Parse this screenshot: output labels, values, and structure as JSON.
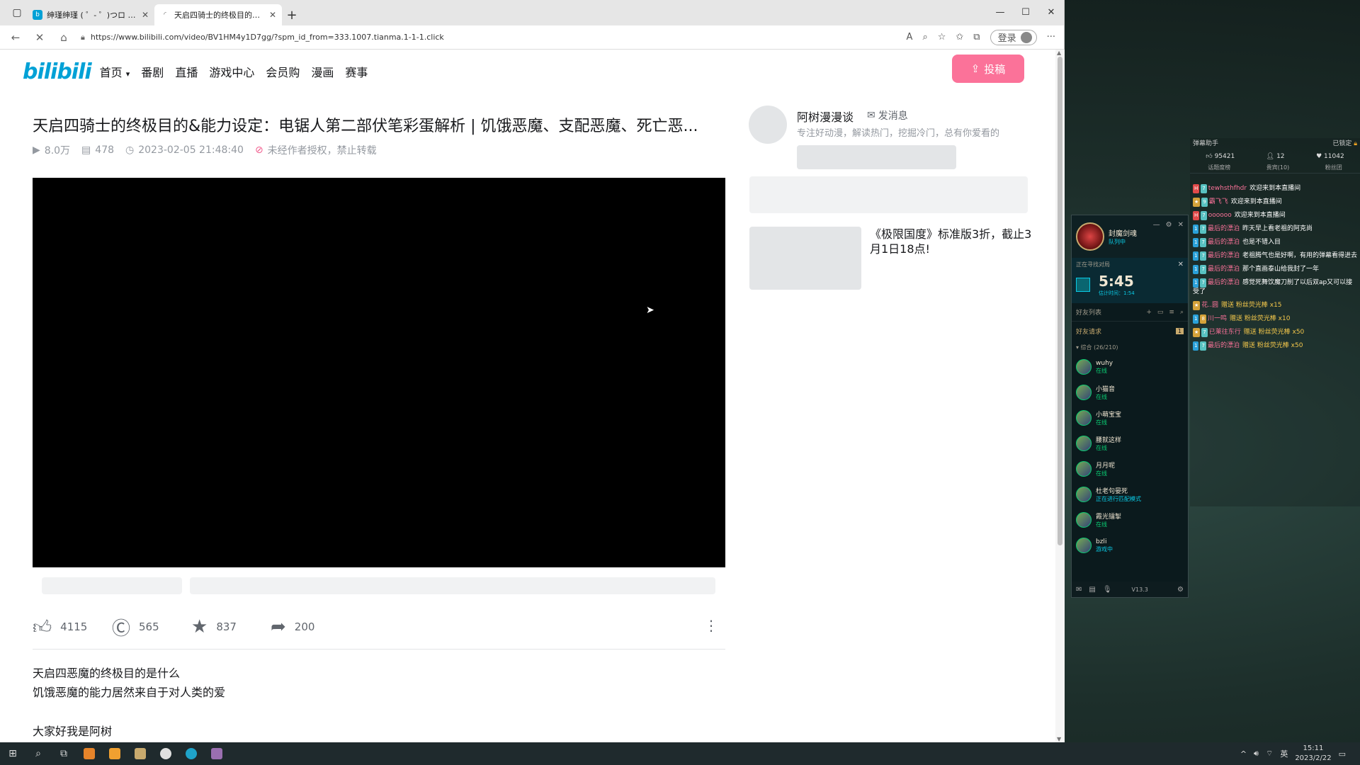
{
  "browser": {
    "tabs": [
      {
        "title": "绅瑾绅瑾 ( ゜- ゜)つロ 干杯~-bilibili",
        "active": false
      },
      {
        "title": "天启四骑士的终极目的&能力设定",
        "active": true
      }
    ],
    "url": "https://www.bilibili.com/video/BV1HM4y1D7gg/?spm_id_from=333.1007.tianma.1-1-1.click",
    "login_label": "登录"
  },
  "header": {
    "logo": "bilibili",
    "nav": [
      "首页",
      "番剧",
      "直播",
      "游戏中心",
      "会员购",
      "漫画",
      "赛事"
    ],
    "upload_label": "投稿"
  },
  "video": {
    "title": "天启四骑士的终极目的&能力设定：电锯人第二部伏笔彩蛋解析 | 饥饿恶魔、支配恶魔、死亡恶...",
    "views": "8.0万",
    "danmaku": "478",
    "date": "2023-02-05 21:48:40",
    "copyright": "未经作者授权，禁止转载",
    "likes": "4115",
    "coins": "565",
    "favorites": "837",
    "shares": "200",
    "description": [
      "天启四恶魔的终极目的是什么",
      "饥饿恶魔的能力居然来自于对人类的爱",
      "大家好我是阿树"
    ]
  },
  "uploader": {
    "name": "阿树漫漫谈",
    "message_label": "发消息",
    "bio": "专注好动漫，解读热门，挖掘冷门，总有你爱看的"
  },
  "ad": {
    "text": "《极限国度》标准版3折，截止3月1日18点!"
  },
  "lol": {
    "summoner": "封魔剑魂",
    "status": "队列中",
    "level": "518",
    "queue_label": "正在寻找对局",
    "timer": "5:45",
    "eta": "估计时间：1:54",
    "friends_label": "好友列表",
    "friend_requests_label": "好友请求",
    "friend_requests_count": "1",
    "group_label": "▾ 综合 (26/210)",
    "friends": [
      {
        "name": "wuhy",
        "status": "在线",
        "game": false
      },
      {
        "name": "小猫音",
        "status": "在线",
        "game": false
      },
      {
        "name": "小萌宝宝",
        "status": "在线",
        "game": false
      },
      {
        "name": "腰就这样",
        "status": "在线",
        "game": false
      },
      {
        "name": "月月呢",
        "status": "在线",
        "game": false
      },
      {
        "name": "杜老句晏死",
        "status": "正在进行匹配模式",
        "game": true
      },
      {
        "name": "霞光镭掣",
        "status": "在线",
        "game": false
      },
      {
        "name": "bzli",
        "status": "游戏中",
        "game": true
      }
    ],
    "version": "V13.3"
  },
  "chat": {
    "title": "弹幕助手",
    "locked": "已锁定",
    "stats": {
      "likes": "95421",
      "viewers": "12",
      "fans": "11042"
    },
    "tabs": [
      "话题度榜",
      "贵宾(10)",
      "粉丝团"
    ],
    "messages": [
      {
        "badges": [
          "red"
        ],
        "user": "tewhsthfhdr",
        "text": "欢迎来到本直播间"
      },
      {
        "badges": [
          "gold"
        ],
        "user": "霸飞飞",
        "text": "欢迎来到本直播间"
      },
      {
        "badges": [
          "red"
        ],
        "user": "oooooo",
        "text": "欢迎来到本直播间"
      },
      {
        "badges": [
          "lv"
        ],
        "user": "最后的漂泊",
        "text": "昨天早上看老祖的阿克尚"
      },
      {
        "badges": [
          "lv"
        ],
        "user": "最后的漂泊",
        "text": "也是不错入目"
      },
      {
        "badges": [
          "lv"
        ],
        "user": "最后的漂泊",
        "text": "老祖腾气也是好啊，有用的弹幕看得进去"
      },
      {
        "badges": [
          "lv"
        ],
        "user": "最后的漂泊",
        "text": "那个直画泰山给我封了一年"
      },
      {
        "badges": [
          "lv"
        ],
        "user": "最后的漂泊",
        "text": "感觉死舞饮魔刀削了以后双ap又可以接受了"
      },
      {
        "badges": [
          "gold"
        ],
        "user": "花..圆",
        "text": "赠送 粉丝荧光棒 x15"
      },
      {
        "badges": [
          "lv"
        ],
        "user": "川一鸣",
        "text": "赠送 粉丝荧光棒 x10"
      },
      {
        "badges": [
          "gold"
        ],
        "user": "已莱往东行",
        "text": "赠送 粉丝荧光棒 x50"
      },
      {
        "badges": [
          "lv"
        ],
        "user": "最后的漂泊",
        "text": "赠送 粉丝荧光棒 x50"
      }
    ]
  },
  "taskbar": {
    "time": "15:11",
    "date": "2023/2/22",
    "ime": "英"
  },
  "colors": {
    "bili_blue": "#00a1d6",
    "bili_pink": "#fb7299",
    "player_bg": "#000000"
  }
}
